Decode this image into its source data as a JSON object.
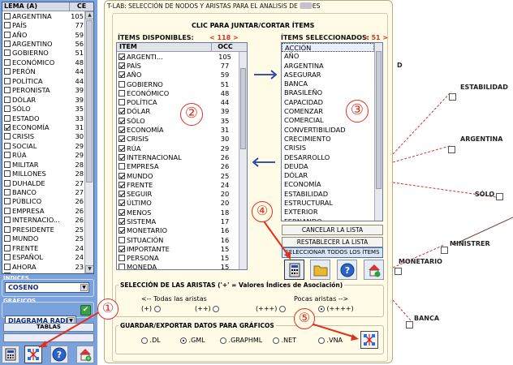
{
  "left": {
    "lema_header": "LEMA (A)",
    "ce_header": "CE",
    "rows": [
      {
        "w": "ARGENTINA",
        "n": "105",
        "c": false
      },
      {
        "w": "PAÍS",
        "n": "77",
        "c": false
      },
      {
        "w": "AÑO",
        "n": "59",
        "c": false
      },
      {
        "w": "ARGENTINO",
        "n": "56",
        "c": false
      },
      {
        "w": "GOBIERNO",
        "n": "51",
        "c": false
      },
      {
        "w": "ECONÓMICO",
        "n": "48",
        "c": false
      },
      {
        "w": "PERÓN",
        "n": "44",
        "c": false
      },
      {
        "w": "POLÍTICA",
        "n": "44",
        "c": false
      },
      {
        "w": "PERONISTA",
        "n": "39",
        "c": false
      },
      {
        "w": "DÓLAR",
        "n": "39",
        "c": false
      },
      {
        "w": "SÓLO",
        "n": "35",
        "c": false
      },
      {
        "w": "ESTADO",
        "n": "33",
        "c": false
      },
      {
        "w": "ECONOMÍA",
        "n": "31",
        "c": true
      },
      {
        "w": "CRISIS",
        "n": "30",
        "c": false
      },
      {
        "w": "SOCIAL",
        "n": "29",
        "c": false
      },
      {
        "w": "RÚA",
        "n": "29",
        "c": false
      },
      {
        "w": "MILITAR",
        "n": "28",
        "c": false
      },
      {
        "w": "MILLONES",
        "n": "28",
        "c": false
      },
      {
        "w": "DUHALDE",
        "n": "27",
        "c": false
      },
      {
        "w": "BANCO",
        "n": "27",
        "c": false
      },
      {
        "w": "PÚBLICO",
        "n": "26",
        "c": false
      },
      {
        "w": "EMPRESA",
        "n": "26",
        "c": false
      },
      {
        "w": "INTERNACIO...",
        "n": "26",
        "c": false
      },
      {
        "w": "PRESIDENTE",
        "n": "25",
        "c": false
      },
      {
        "w": "MUNDO",
        "n": "25",
        "c": false
      },
      {
        "w": "FRENTE",
        "n": "24",
        "c": false
      },
      {
        "w": "ESPAÑOL",
        "n": "24",
        "c": false
      },
      {
        "w": "AHORA",
        "n": "23",
        "c": false
      },
      {
        "w": "CAMBIO",
        "n": "23",
        "c": false
      }
    ],
    "indices_label": "ÍNDICES",
    "indices_value": "COSENO",
    "graficos_label": "GRÁFICOS",
    "graficos_value": "DIAGRAMA RADIA",
    "tablas_btn": "TABLAS",
    "otros_btn": "OTROS SUBCONJUNTOS"
  },
  "dialog": {
    "title": "T-LAB: SELECCIÓN DE NODOS Y ARISTAS PARA EL ANALISIS DE REDES",
    "heading": "CLIC  PARA JUNTAR/CORTAR ÍTEMS",
    "available_label": "ÍTEMS DISPONIBLES:",
    "available_count": "< 118 >",
    "selected_label": "ÍTEMS SELECCIONADOS:",
    "selected_count": "< 51 >",
    "item_header": "ITEM",
    "occ_header": "OCC",
    "available": [
      {
        "w": "ARGENTI...",
        "n": "105"
      },
      {
        "w": "PAÍS",
        "n": "77"
      },
      {
        "w": "AÑO",
        "n": "59"
      },
      {
        "w": "GOBIERNO",
        "n": "51"
      },
      {
        "w": "ECONÓMICO",
        "n": "48"
      },
      {
        "w": "POLÍTICA",
        "n": "44"
      },
      {
        "w": "DÓLAR",
        "n": "39"
      },
      {
        "w": "SÓLO",
        "n": "35"
      },
      {
        "w": "ECONOMÍA",
        "n": "31"
      },
      {
        "w": "CRISIS",
        "n": "30"
      },
      {
        "w": "RÚA",
        "n": "29"
      },
      {
        "w": "INTERNACIONAL",
        "n": "26"
      },
      {
        "w": "EMPRESA",
        "n": "26"
      },
      {
        "w": "MUNDO",
        "n": "25"
      },
      {
        "w": "FRENTE",
        "n": "24"
      },
      {
        "w": "SEGUIR",
        "n": "20"
      },
      {
        "w": "ÚLTIMO",
        "n": "20"
      },
      {
        "w": "MENOS",
        "n": "18"
      },
      {
        "w": "SISTEMA",
        "n": "17"
      },
      {
        "w": "MONETARIO",
        "n": "16"
      },
      {
        "w": "SITUACIÓN",
        "n": "16"
      },
      {
        "w": "IMPORTANTE",
        "n": "15"
      },
      {
        "w": "PERSONA",
        "n": "15"
      },
      {
        "w": "MONEDA",
        "n": "15"
      }
    ],
    "available_checked": [
      true,
      true,
      true,
      false,
      false,
      false,
      true,
      true,
      true,
      true,
      true,
      true,
      false,
      true,
      true,
      true,
      true,
      true,
      true,
      true,
      false,
      true,
      false,
      false
    ],
    "selected": [
      "ACCIÓN",
      "AÑO",
      "ARGENTINA",
      "ASEGURAR",
      "BANCA",
      "BRASILEÑO",
      "CAPACIDAD",
      "COMENZAR",
      "COMERCIAL",
      "CONVERTIBILIDAD",
      "CRECIMIENTO",
      "CRISIS",
      "DESARROLLO",
      "DEUDA",
      "DÓLAR",
      "ECONOMÍA",
      "ESTABILIDAD",
      "ESTRUCTURAL",
      "EXTERIOR",
      "FERNANDO",
      "FONDO"
    ],
    "cancel_btn": "CANCELAR LA LISTA",
    "restore_btn": "RESTABLECER LA LISTA",
    "select_all_btn": "SELECCIONAR TODOS LOS ÍTEMS",
    "edges_legend": "SELECCIÓN DE LAS ARISTAS ('+' = Valores Índices de Asociación)",
    "edges_all": "<-- Todas las aristas",
    "edges_few": "Pocas aristas -->",
    "edge_opts": [
      "(+)",
      "(++)",
      "(+++)",
      "(++++)"
    ],
    "save_legend": "GUARDAR/EXPORTAR DATOS PARA GRÁFICOS",
    "save_opts": [
      ".DL",
      ".GML",
      ".GRAPHML",
      ".NET",
      ".VNA"
    ]
  },
  "callouts": [
    "①",
    "②",
    "③",
    "④",
    "⑤"
  ],
  "graph": {
    "nodes": [
      "ESTABILIDAD",
      "ARGENTINA",
      "SÓLO",
      "MINISTRER",
      "MONETARIO",
      "BANCA",
      "D"
    ]
  },
  "colors": {
    "accent_red": "#e0301e",
    "panel_blue": "#7aa2dc",
    "dialog_bg": "#fffbe6",
    "navy": "#0c2a80"
  }
}
